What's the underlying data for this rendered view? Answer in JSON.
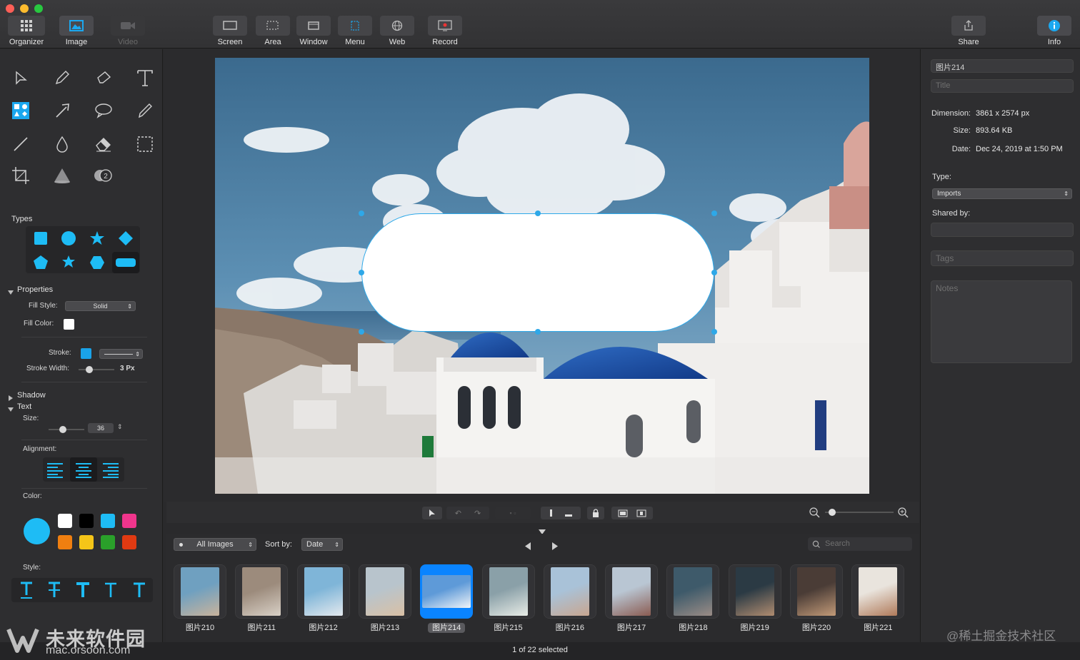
{
  "toolbar": {
    "items": [
      {
        "label": "Organizer",
        "icon": "grid-icon"
      },
      {
        "label": "Image",
        "icon": "image-icon"
      },
      {
        "label": "Video",
        "icon": "video-camera-icon"
      },
      {
        "label": "Screen",
        "icon": "screen-icon"
      },
      {
        "label": "Area",
        "icon": "area-icon"
      },
      {
        "label": "Window",
        "icon": "window-icon"
      },
      {
        "label": "Menu",
        "icon": "menu-icon"
      },
      {
        "label": "Web",
        "icon": "globe-icon"
      },
      {
        "label": "Record",
        "icon": "record-icon"
      },
      {
        "label": "Share",
        "icon": "share-icon"
      },
      {
        "label": "Info",
        "icon": "info-icon"
      }
    ]
  },
  "left": {
    "types_label": "Types",
    "properties_label": "Properties",
    "fill_style_label": "Fill Style:",
    "fill_style_value": "Solid",
    "fill_color_label": "Fill Color:",
    "stroke_label": "Stroke:",
    "stroke_width_label": "Stroke Width:",
    "stroke_width_value": "3 Px",
    "stroke_width_level": 0.3,
    "shadow_label": "Shadow",
    "text_label": "Text",
    "size_label": "Size:",
    "size_value": "36",
    "size_level": 0.4,
    "alignment_label": "Alignment:",
    "color_label": "Color:",
    "style_label": "Style:",
    "colors": {
      "accent": "#1aa3e8",
      "selected": "#1ebcf5",
      "swatches": [
        "#ffffff",
        "#000000",
        "#1ebcf5",
        "#f0358c",
        "#f07f10",
        "#f5c518",
        "#2aa02a",
        "#e03a12"
      ]
    }
  },
  "right": {
    "name_value": "图片214",
    "title_placeholder": "Title",
    "dimension_label": "Dimension:",
    "dimension_value": "3861 x 2574 px",
    "size_label": "Size:",
    "size_value": "893.64 KB",
    "date_label": "Date:",
    "date_value": "Dec 24, 2019 at 1:50 PM",
    "type_label": "Type:",
    "type_value": "Imports",
    "shared_by_label": "Shared by:",
    "tags_placeholder": "Tags",
    "notes_placeholder": "Notes"
  },
  "browser": {
    "filter_value": "All Images",
    "sort_label": "Sort by:",
    "sort_value": "Date",
    "search_placeholder": "Search",
    "thumbnails": [
      "图片210",
      "图片211",
      "图片212",
      "图片213",
      "图片214",
      "图片215",
      "图片216",
      "图片217",
      "图片218",
      "图片219",
      "图片220",
      "图片221"
    ],
    "selected_index": 4
  },
  "zoom_level": 0.1,
  "status": {
    "selection": "1 of 22 selected"
  },
  "watermark": {
    "brand": "未来软件园",
    "url": "mac.orsoon.com",
    "credit": "@稀土掘金技术社区"
  }
}
